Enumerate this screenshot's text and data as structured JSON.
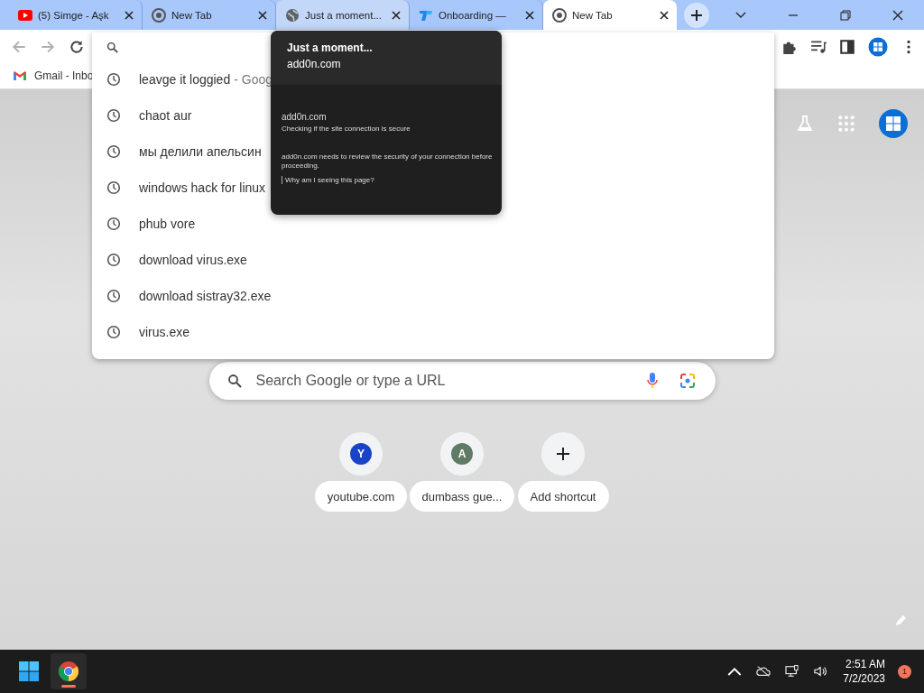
{
  "tabs": [
    {
      "kind": "youtube",
      "title": "(5) Simge - Aşk",
      "selected": false,
      "hovered": false
    },
    {
      "kind": "chrome",
      "title": "New Tab",
      "selected": false,
      "hovered": false
    },
    {
      "kind": "globe",
      "title": "Just a moment...",
      "selected": false,
      "hovered": true
    },
    {
      "kind": "app",
      "title": "Onboarding —",
      "selected": false,
      "hovered": false
    },
    {
      "kind": "chrome",
      "title": "New Tab",
      "selected": true,
      "hovered": false
    }
  ],
  "toolbar": {
    "forward_disabled": true,
    "back_disabled": true
  },
  "bookmarks": [
    {
      "kind": "gmail",
      "label": "Gmail - Inbo"
    }
  ],
  "omnibox": {
    "suggestions": [
      {
        "text": "leavge it loggied",
        "suffix": "- Goog"
      },
      {
        "text": "chaot aur"
      },
      {
        "text": "мы делили апельсин"
      },
      {
        "text": "windows hack for linux"
      },
      {
        "text": "phub vore"
      },
      {
        "text": "download virus.exe"
      },
      {
        "text": "download sistray32.exe"
      },
      {
        "text": "virus.exe"
      }
    ]
  },
  "tab_preview": {
    "title": "Just a moment...",
    "domain": "add0n.com",
    "page_heading": "add0n.com",
    "page_subtitle": "Checking if the site connection is secure",
    "page_body": "add0n.com needs to review the security of your connection before proceeding.",
    "page_link": "Why am I seeing this page?"
  },
  "new_tab": {
    "search_placeholder": "Search Google or type a URL",
    "shortcuts": [
      {
        "kind": "site",
        "initial": "Y",
        "color": "#1a44c8",
        "label": "youtube.com"
      },
      {
        "kind": "site",
        "initial": "A",
        "color": "#607a66",
        "label": "dumbass gue..."
      },
      {
        "kind": "add",
        "label": "Add shortcut"
      }
    ]
  },
  "taskbar": {
    "time": "2:51 AM",
    "date": "7/2/2023",
    "notifications": "1"
  }
}
